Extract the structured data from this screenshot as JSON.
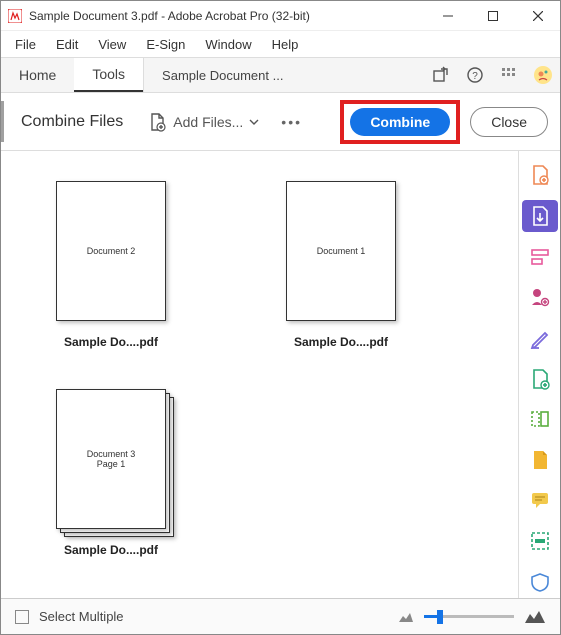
{
  "window": {
    "title": "Sample Document 3.pdf - Adobe Acrobat Pro (32-bit)"
  },
  "menubar": [
    "File",
    "Edit",
    "View",
    "E-Sign",
    "Window",
    "Help"
  ],
  "topnav": {
    "home": "Home",
    "tools": "Tools",
    "tab": "Sample Document ..."
  },
  "toolbar": {
    "title": "Combine Files",
    "add_files": "Add Files...",
    "combine": "Combine",
    "close": "Close"
  },
  "documents": [
    {
      "label": "Sample Do....pdf",
      "preview_lines": [
        "Document 2"
      ]
    },
    {
      "label": "Sample Do....pdf",
      "preview_lines": [
        "Document 1"
      ]
    },
    {
      "label": "Sample Do....pdf",
      "preview_lines": [
        "Document 3",
        "Page 1"
      ],
      "multi": true
    }
  ],
  "footer": {
    "select_multiple": "Select Multiple"
  },
  "rail_icons": [
    "create-pdf-icon",
    "export-pdf-icon",
    "edit-pdf-icon",
    "sign-icon",
    "annotate-icon",
    "organize-icon",
    "compare-icon",
    "stamp-icon",
    "comment-icon",
    "redact-icon",
    "protect-icon"
  ]
}
